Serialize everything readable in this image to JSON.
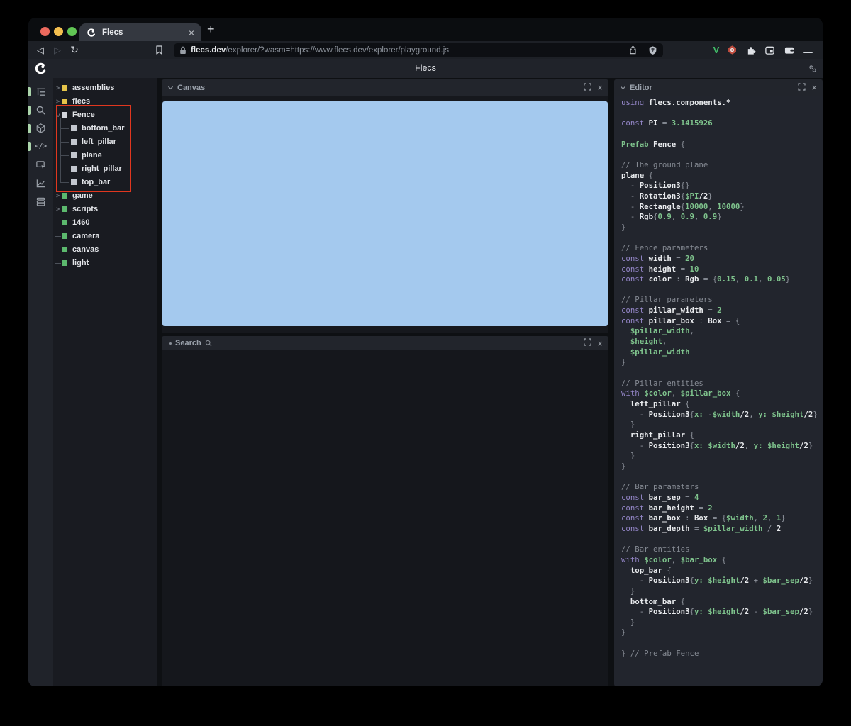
{
  "browser": {
    "tab": {
      "title": "Flecs",
      "close_glyph": "×"
    },
    "new_tab_glyph": "+",
    "nav": {
      "back_glyph": "◁",
      "forward_glyph": "▷",
      "reload_glyph": "↻"
    },
    "url": {
      "domain": "flecs.dev",
      "path": "/explorer/?wasm=https://www.flecs.dev/explorer/playground.js"
    },
    "extension_icons": [
      "v-extension-icon",
      "hex-extension-icon",
      "puzzle-extensions-icon",
      "sidebar-toggle-icon",
      "wallet-icon",
      "menu-icon"
    ]
  },
  "app": {
    "title": "Flecs"
  },
  "sidebar": {
    "icons": [
      {
        "name": "hierarchy-icon",
        "active": true
      },
      {
        "name": "search-icon",
        "active": true
      },
      {
        "name": "cube-icon",
        "active": true
      },
      {
        "name": "code-icon",
        "active": true,
        "glyph": "</>"
      },
      {
        "name": "inspector-icon",
        "active": false
      },
      {
        "name": "chart-icon",
        "active": false
      },
      {
        "name": "rows-icon",
        "active": false
      }
    ]
  },
  "tree": {
    "items": [
      {
        "label": "assemblies",
        "square": "yellow",
        "marker": "collapsed"
      },
      {
        "label": "flecs",
        "square": "yellow",
        "marker": "collapsed"
      },
      {
        "label": "Fence",
        "square": "white",
        "marker": "expanded"
      },
      {
        "label": "bottom_bar",
        "square": "gray",
        "marker": "child"
      },
      {
        "label": "left_pillar",
        "square": "gray",
        "marker": "child"
      },
      {
        "label": "plane",
        "square": "gray",
        "marker": "child"
      },
      {
        "label": "right_pillar",
        "square": "gray",
        "marker": "child"
      },
      {
        "label": "top_bar",
        "square": "gray",
        "marker": "child"
      },
      {
        "label": "game",
        "square": "green",
        "marker": "collapsed"
      },
      {
        "label": "scripts",
        "square": "green",
        "marker": "collapsed"
      },
      {
        "label": "1460",
        "square": "green",
        "marker": "leaf"
      },
      {
        "label": "camera",
        "square": "green",
        "marker": "leaf"
      },
      {
        "label": "canvas",
        "square": "green",
        "marker": "leaf"
      },
      {
        "label": "light",
        "square": "green",
        "marker": "leaf"
      }
    ]
  },
  "panels": {
    "canvas": {
      "title": "Canvas",
      "close_glyph": "×"
    },
    "search": {
      "title": "Search",
      "close_glyph": "×"
    },
    "editor": {
      "title": "Editor",
      "close_glyph": "×"
    }
  },
  "colors": {
    "canvas_blue": "#a4c9ee",
    "annotation_red": "#e0371f",
    "entity_yellow": "#e5c44a",
    "entity_green": "#5cb96e",
    "entity_white": "#d2d5dc",
    "entity_gray": "#c3c7cf",
    "keyword_purple": "#9486c8",
    "code_green": "#7fc48d",
    "active_pill_green": "#abd5ab",
    "brave_v_green": "#41bd68"
  },
  "code": {
    "lines": [
      [
        [
          "k",
          "using "
        ],
        [
          "i",
          "flecs.components.*"
        ]
      ],
      [],
      [
        [
          "k",
          "const "
        ],
        [
          "i",
          "PI"
        ],
        [
          "p",
          " = "
        ],
        [
          "g",
          "3.1415926"
        ]
      ],
      [],
      [
        [
          "g",
          "Prefab "
        ],
        [
          "i",
          "Fence "
        ],
        [
          "p",
          "{"
        ]
      ],
      [],
      [
        [
          "c",
          "// The ground plane"
        ]
      ],
      [
        [
          "i",
          "plane "
        ],
        [
          "p",
          "{"
        ]
      ],
      [
        [
          "p",
          "  - "
        ],
        [
          "i",
          "Position3"
        ],
        [
          "p",
          "{}"
        ]
      ],
      [
        [
          "p",
          "  - "
        ],
        [
          "i",
          "Rotation3"
        ],
        [
          "p",
          "{"
        ],
        [
          "g",
          "$PI"
        ],
        [
          "i",
          "/2"
        ],
        [
          "p",
          "}"
        ]
      ],
      [
        [
          "p",
          "  - "
        ],
        [
          "i",
          "Rectangle"
        ],
        [
          "p",
          "{"
        ],
        [
          "g",
          "10000"
        ],
        [
          "p",
          ", "
        ],
        [
          "g",
          "10000"
        ],
        [
          "p",
          "}"
        ]
      ],
      [
        [
          "p",
          "  - "
        ],
        [
          "i",
          "Rgb"
        ],
        [
          "p",
          "{"
        ],
        [
          "g",
          "0.9"
        ],
        [
          "p",
          ", "
        ],
        [
          "g",
          "0.9"
        ],
        [
          "p",
          ", "
        ],
        [
          "g",
          "0.9"
        ],
        [
          "p",
          "}"
        ]
      ],
      [
        [
          "p",
          "}"
        ]
      ],
      [],
      [
        [
          "c",
          "// Fence parameters"
        ]
      ],
      [
        [
          "k",
          "const "
        ],
        [
          "i",
          "width"
        ],
        [
          "p",
          " = "
        ],
        [
          "g",
          "20"
        ]
      ],
      [
        [
          "k",
          "const "
        ],
        [
          "i",
          "height"
        ],
        [
          "p",
          " = "
        ],
        [
          "g",
          "10"
        ]
      ],
      [
        [
          "k",
          "const "
        ],
        [
          "i",
          "color"
        ],
        [
          "p",
          " : "
        ],
        [
          "i",
          "Rgb"
        ],
        [
          "p",
          " = {"
        ],
        [
          "g",
          "0.15"
        ],
        [
          "p",
          ", "
        ],
        [
          "g",
          "0.1"
        ],
        [
          "p",
          ", "
        ],
        [
          "g",
          "0.05"
        ],
        [
          "p",
          "}"
        ]
      ],
      [],
      [
        [
          "c",
          "// Pillar parameters"
        ]
      ],
      [
        [
          "k",
          "const "
        ],
        [
          "i",
          "pillar_width"
        ],
        [
          "p",
          " = "
        ],
        [
          "g",
          "2"
        ]
      ],
      [
        [
          "k",
          "const "
        ],
        [
          "i",
          "pillar_box"
        ],
        [
          "p",
          " : "
        ],
        [
          "i",
          "Box"
        ],
        [
          "p",
          " = {"
        ]
      ],
      [
        [
          "p",
          "  "
        ],
        [
          "g",
          "$pillar_width"
        ],
        [
          "p",
          ","
        ]
      ],
      [
        [
          "p",
          "  "
        ],
        [
          "g",
          "$height"
        ],
        [
          "p",
          ","
        ]
      ],
      [
        [
          "p",
          "  "
        ],
        [
          "g",
          "$pillar_width"
        ]
      ],
      [
        [
          "p",
          "}"
        ]
      ],
      [],
      [
        [
          "c",
          "// Pillar entities"
        ]
      ],
      [
        [
          "k",
          "with "
        ],
        [
          "g",
          "$color"
        ],
        [
          "p",
          ", "
        ],
        [
          "g",
          "$pillar_box"
        ],
        [
          "p",
          " {"
        ]
      ],
      [
        [
          "p",
          "  "
        ],
        [
          "i",
          "left_pillar "
        ],
        [
          "p",
          "{"
        ]
      ],
      [
        [
          "p",
          "    - "
        ],
        [
          "i",
          "Position3"
        ],
        [
          "p",
          "{"
        ],
        [
          "g",
          "x:"
        ],
        [
          "p",
          " -"
        ],
        [
          "g",
          "$width"
        ],
        [
          "i",
          "/2"
        ],
        [
          "p",
          ", "
        ],
        [
          "g",
          "y: $height"
        ],
        [
          "i",
          "/2"
        ],
        [
          "p",
          "}"
        ]
      ],
      [
        [
          "p",
          "  }"
        ]
      ],
      [
        [
          "p",
          "  "
        ],
        [
          "i",
          "right_pillar "
        ],
        [
          "p",
          "{"
        ]
      ],
      [
        [
          "p",
          "    - "
        ],
        [
          "i",
          "Position3"
        ],
        [
          "p",
          "{"
        ],
        [
          "g",
          "x: $width"
        ],
        [
          "i",
          "/2"
        ],
        [
          "p",
          ", "
        ],
        [
          "g",
          "y: $height"
        ],
        [
          "i",
          "/2"
        ],
        [
          "p",
          "}"
        ]
      ],
      [
        [
          "p",
          "  }"
        ]
      ],
      [
        [
          "p",
          "}"
        ]
      ],
      [],
      [
        [
          "c",
          "// Bar parameters"
        ]
      ],
      [
        [
          "k",
          "const "
        ],
        [
          "i",
          "bar_sep"
        ],
        [
          "p",
          " = "
        ],
        [
          "g",
          "4"
        ]
      ],
      [
        [
          "k",
          "const "
        ],
        [
          "i",
          "bar_height"
        ],
        [
          "p",
          " = "
        ],
        [
          "g",
          "2"
        ]
      ],
      [
        [
          "k",
          "const "
        ],
        [
          "i",
          "bar_box"
        ],
        [
          "p",
          " : "
        ],
        [
          "i",
          "Box"
        ],
        [
          "p",
          " = {"
        ],
        [
          "g",
          "$width"
        ],
        [
          "p",
          ", "
        ],
        [
          "g",
          "2"
        ],
        [
          "p",
          ", "
        ],
        [
          "g",
          "1"
        ],
        [
          "p",
          "}"
        ]
      ],
      [
        [
          "k",
          "const "
        ],
        [
          "i",
          "bar_depth"
        ],
        [
          "p",
          " = "
        ],
        [
          "g",
          "$pillar_width"
        ],
        [
          "p",
          " / "
        ],
        [
          "i",
          "2"
        ]
      ],
      [],
      [
        [
          "c",
          "// Bar entities"
        ]
      ],
      [
        [
          "k",
          "with "
        ],
        [
          "g",
          "$color"
        ],
        [
          "p",
          ", "
        ],
        [
          "g",
          "$bar_box"
        ],
        [
          "p",
          " {"
        ]
      ],
      [
        [
          "p",
          "  "
        ],
        [
          "i",
          "top_bar "
        ],
        [
          "p",
          "{"
        ]
      ],
      [
        [
          "p",
          "    - "
        ],
        [
          "i",
          "Position3"
        ],
        [
          "p",
          "{"
        ],
        [
          "g",
          "y: $height"
        ],
        [
          "i",
          "/2"
        ],
        [
          "p",
          " + "
        ],
        [
          "g",
          "$bar_sep"
        ],
        [
          "i",
          "/2"
        ],
        [
          "p",
          "}"
        ]
      ],
      [
        [
          "p",
          "  }"
        ]
      ],
      [
        [
          "p",
          "  "
        ],
        [
          "i",
          "bottom_bar "
        ],
        [
          "p",
          "{"
        ]
      ],
      [
        [
          "p",
          "    - "
        ],
        [
          "i",
          "Position3"
        ],
        [
          "p",
          "{"
        ],
        [
          "g",
          "y: $height"
        ],
        [
          "i",
          "/2"
        ],
        [
          "p",
          " - "
        ],
        [
          "g",
          "$bar_sep"
        ],
        [
          "i",
          "/2"
        ],
        [
          "p",
          "}"
        ]
      ],
      [
        [
          "p",
          "  }"
        ]
      ],
      [
        [
          "p",
          "}"
        ]
      ],
      [],
      [
        [
          "p",
          "} "
        ],
        [
          "c",
          "// Prefab Fence"
        ]
      ]
    ]
  }
}
